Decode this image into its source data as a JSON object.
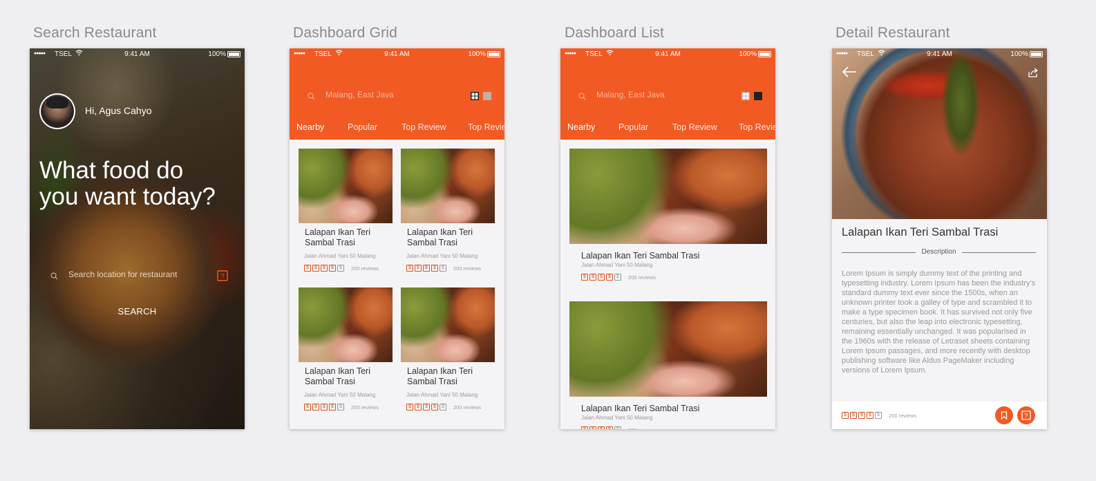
{
  "screens": [
    {
      "title": "Search Restaurant"
    },
    {
      "title": "Dashboard Grid"
    },
    {
      "title": "Dashboard List"
    },
    {
      "title": "Detail Restaurant"
    }
  ],
  "status_bar": {
    "carrier": "TSEL",
    "time": "9:41 AM",
    "battery": "100%"
  },
  "search_screen": {
    "greeting": "Hi, Agus Cahyo",
    "headline_line1": "What food do",
    "headline_line2": "you want today?",
    "search_placeholder": "Search location for restaurant",
    "search_button": "SEARCH"
  },
  "dashboard": {
    "location": "Malang, East Java",
    "tabs": [
      "Nearby",
      "Popular",
      "Top Review",
      "Top Review"
    ],
    "active_tab": "Nearby",
    "restaurant": {
      "name_line1": "Lalapan Ikan Teri",
      "name_line2": "Sambal Trasi",
      "name": "Lalapan Ikan Teri Sambal Trasi",
      "address": "Jalan Ahmad Yani 50 Malang",
      "reviews": "200 reviews",
      "rating": 4,
      "rating_max": 5
    }
  },
  "detail": {
    "name": "Lalapan Ikan Teri Sambal Trasi",
    "section_label": "Description",
    "description": "Lorem Ipsum is simply dummy text of the printing and typesetting industry. Lorem Ipsum has been the industry's standard dummy text ever since the 1500s, when an unknown printer took a galley of type and scrambled it to make a type specimen book. It has survived not only five centuries, but also the leap into electronic typesetting, remaining essentially unchanged. It was popularised in the 1960s with the release of Letraset sheets containing Lorem Ipsum passages, and more recently with desktop publishing software like Aldus PageMaker including versions of Lorem Ipsum.",
    "reviews": "200 reviews",
    "rating": 4
  },
  "colors": {
    "accent": "#f25a23",
    "background": "#efeff1"
  },
  "icons": [
    "search-icon",
    "wifi-icon",
    "location-icon",
    "grid-view-icon",
    "list-view-icon",
    "back-arrow-icon",
    "share-icon",
    "bookmark-icon",
    "star-icon"
  ]
}
